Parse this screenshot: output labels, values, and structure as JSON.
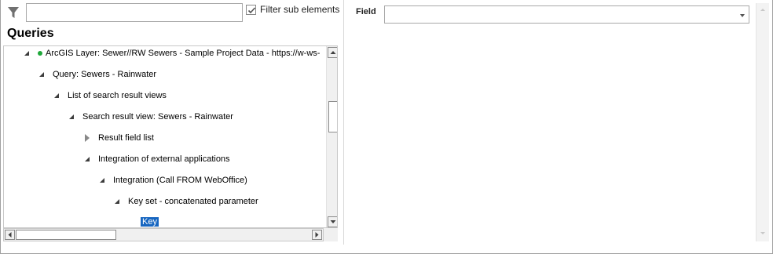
{
  "filter": {
    "input_value": "",
    "checkbox_label": "Filter sub elements",
    "checkbox_checked": true
  },
  "queries_title": "Queries",
  "tree": [
    {
      "label": "ArcGIS Layer: Sewer//RW Sewers - Sample Project Data - https://w-ws-",
      "state": "expanded",
      "status_dot": "#1fa83a"
    },
    {
      "label": "Query: Sewers - Rainwater",
      "state": "expanded"
    },
    {
      "label": "List of search result views",
      "state": "expanded"
    },
    {
      "label": "Search result view: Sewers - Rainwater",
      "state": "expanded"
    },
    {
      "label": "Result field list",
      "state": "collapsed"
    },
    {
      "label": "Integration of external applications",
      "state": "expanded"
    },
    {
      "label": "Integration (Call FROM WebOffice)",
      "state": "expanded"
    },
    {
      "label": "Key set - concatenated parameter",
      "state": "expanded"
    },
    {
      "label": "Key",
      "state": "selected"
    }
  ],
  "right": {
    "field_label": "Field",
    "field_value": ""
  },
  "colors": {
    "selection": "#1766c0",
    "status_green": "#1fa83a"
  },
  "icons": {
    "filter": "funnel-icon",
    "checkbox": "checkmark-icon"
  }
}
